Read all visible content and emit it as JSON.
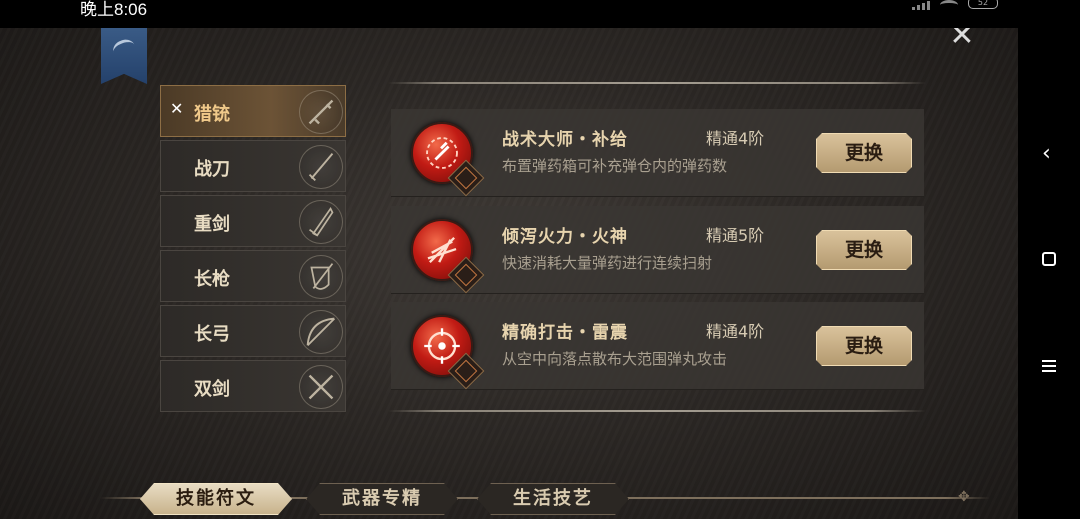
{
  "status": {
    "time": "晚上8:06",
    "battery": "52"
  },
  "weapons": [
    {
      "label": "猎铳",
      "icon": "rifle-icon",
      "active": true
    },
    {
      "label": "战刀",
      "icon": "sabre-icon",
      "active": false
    },
    {
      "label": "重剑",
      "icon": "greatsword-icon",
      "active": false
    },
    {
      "label": "长枪",
      "icon": "spear-icon",
      "active": false
    },
    {
      "label": "长弓",
      "icon": "bow-icon",
      "active": false
    },
    {
      "label": "双剑",
      "icon": "dual-swords-icon",
      "active": false
    }
  ],
  "skills": [
    {
      "name": "战术大师・补给",
      "level": "精通4阶",
      "desc": "布置弹药箱可补充弹仓内的弹药数",
      "button": "更换",
      "icon": "ammo-supply-icon"
    },
    {
      "name": "倾泻火力・火神",
      "level": "精通5阶",
      "desc": "快速消耗大量弹药进行连续扫射",
      "button": "更换",
      "icon": "barrage-icon"
    },
    {
      "name": "精确打击・雷震",
      "level": "精通4阶",
      "desc": "从空中向落点散布大范围弹丸攻击",
      "button": "更换",
      "icon": "target-strike-icon"
    }
  ],
  "tabs": [
    {
      "label": "技能符文",
      "active": true
    },
    {
      "label": "武器专精",
      "active": false
    },
    {
      "label": "生活技艺",
      "active": false
    }
  ],
  "colors": {
    "accent": "#c11b14",
    "active_tab": "#e8dcc3",
    "button": "#d9c29b"
  }
}
